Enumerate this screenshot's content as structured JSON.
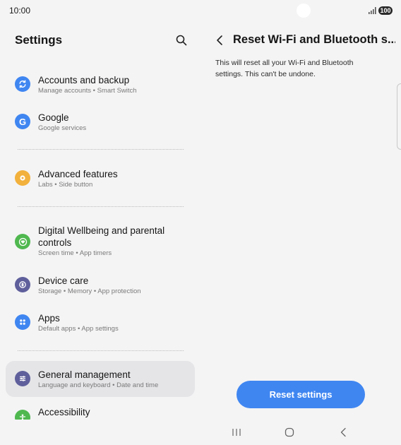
{
  "status_bar": {
    "time": "10:00",
    "battery": "100"
  },
  "left_pane": {
    "title": "Settings",
    "items": [
      {
        "title": "Accounts and backup",
        "subtitle": "Manage accounts  •  Smart Switch",
        "icon": "sync-icon",
        "color": "#3f86f1"
      },
      {
        "title": "Google",
        "subtitle": "Google services",
        "icon": "google-g-icon",
        "color": "#3f86f1"
      },
      {
        "title": "Advanced features",
        "subtitle": "Labs  •  Side button",
        "icon": "gear-plus-icon",
        "color": "#f2b13c"
      },
      {
        "title": "Digital Wellbeing and parental controls",
        "subtitle": "Screen time  •  App timers",
        "icon": "heart-ring-icon",
        "color": "#4fb84f"
      },
      {
        "title": "Device care",
        "subtitle": "Storage  •  Memory  •  App protection",
        "icon": "device-care-icon",
        "color": "#5f5f9c"
      },
      {
        "title": "Apps",
        "subtitle": "Default apps  •  App settings",
        "icon": "apps-grid-icon",
        "color": "#3f86f1"
      },
      {
        "title": "General management",
        "subtitle": "Language and keyboard  •  Date and time",
        "icon": "sliders-icon",
        "color": "#5f5f9c"
      },
      {
        "title": "Accessibility",
        "subtitle": "",
        "icon": "accessibility-icon",
        "color": "#4fb84f"
      }
    ]
  },
  "right_pane": {
    "title": "Reset Wi-Fi and Bluetooth s...",
    "description": "This will reset all your Wi-Fi and Bluetooth settings. This can't be undone.",
    "reset_button": "Reset settings"
  },
  "colors": {
    "accent": "#3f86f1",
    "background": "#f4f4f5",
    "selected": "#e5e5e8"
  }
}
